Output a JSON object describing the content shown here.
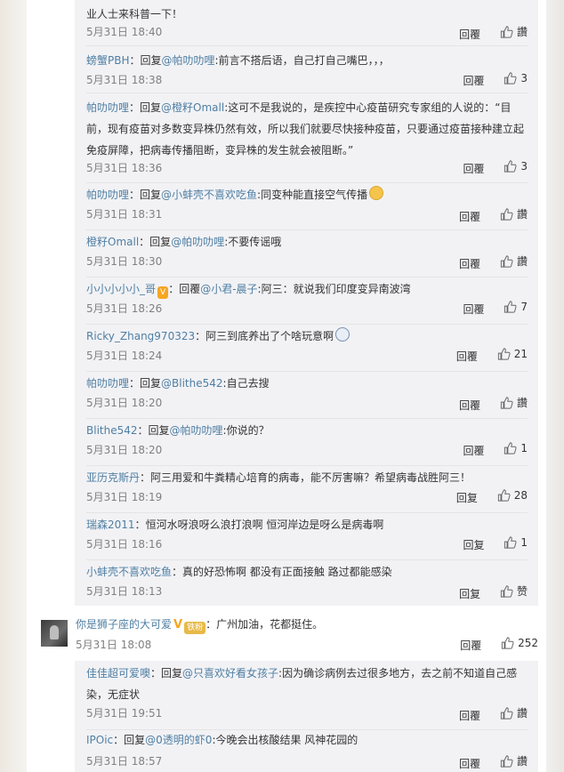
{
  "labels": {
    "reply": "回覆",
    "reply_alt": "回复",
    "like": "讚",
    "like_alt": "赞"
  },
  "replies_group1": [
    {
      "name": "",
      "text": "业人士来科普一下！",
      "time": "5月31日 18:40",
      "likes": "讚"
    },
    {
      "name": "螃蟹PBH",
      "prefix": "：回复",
      "mention": "@帕叻叻哩",
      "text": ":前言不搭后语，自己打自己嘴巴，，，",
      "time": "5月31日 18:38",
      "likes": "3"
    },
    {
      "name": "帕叻叻哩",
      "prefix": "：回复",
      "mention": "@橙籽Omall",
      "text": ":这可不是我说的，是疾控中心疫苗研究专家组的人说的：“目前，现有疫苗对多数变异株仍然有效，所以我们就要尽快接种疫苗，只要通过疫苗接种建立起免疫屏障，把病毒传播阻断，变异株的发生就会被阻断。”",
      "time": "5月31日 18:36",
      "likes": "3"
    },
    {
      "name": "帕叻叻哩",
      "prefix": "：回复",
      "mention": "@小蚌壳不喜欢吃鱼",
      "text": ":同变种能直接空气传播",
      "time": "5月31日 18:31",
      "likes": "讚"
    },
    {
      "name": "橙籽Omall",
      "prefix": "：回复",
      "mention": "@帕叻叻哩",
      "text": ":不要传谣哦",
      "time": "5月31日 18:30",
      "likes": "讚"
    },
    {
      "name": "小小小小小_哥",
      "badge": "V",
      "prefix": "：回覆",
      "mention": "@小君-晨子",
      "text": ":阿三：就说我们印度变异南波湾",
      "time": "5月31日 18:26",
      "likes": "7"
    },
    {
      "name": "Ricky_Zhang970323",
      "prefix": "：",
      "mention": "",
      "text": "阿三到底养出了个啥玩意啊",
      "time": "5月31日 18:24",
      "likes": "21"
    },
    {
      "name": "帕叻叻哩",
      "prefix": "：回复",
      "mention": "@Blithe542",
      "text": ":自己去搜",
      "time": "5月31日 18:20",
      "likes": "讚"
    },
    {
      "name": "Blithe542",
      "prefix": "：回复",
      "mention": "@帕叻叻哩",
      "text": ":你说的？",
      "time": "5月31日 18:20",
      "likes": "1"
    },
    {
      "name": "亚历克斯丹",
      "prefix": "：",
      "mention": "",
      "text": "阿三用爱和牛粪精心培育的病毒，能不厉害嘛？希望病毒战胜阿三！",
      "time": "5月31日 18:19",
      "likes": "28"
    },
    {
      "name": "瑞森2011",
      "prefix": "：",
      "mention": "",
      "text": "恒河水呀浪呀么浪打浪啊 恒河岸边是呀么是病毒啊",
      "time": "5月31日 18:16",
      "likes": "1"
    },
    {
      "name": "小蚌壳不喜欢吃鱼",
      "prefix": "：",
      "mention": "",
      "text": "真的好恐怖啊 都没有正面接触 路过都能感染",
      "time": "5月31日 18:13",
      "likes": "赞"
    }
  ],
  "main_comment": {
    "name": "你是狮子座的大可爱",
    "badge_text": "铁粉",
    "text": "：广州加油，花都挺住。",
    "time": "5月31日 18:08",
    "likes": "252"
  },
  "replies_group2": [
    {
      "name": "佳佳超可爱噢",
      "prefix": "：回复",
      "mention": "@只喜欢好看女孩子",
      "text": ":因为确诊病例去过很多地方，去之前不知道自己感染，无症状",
      "time": "5月31日 19:51",
      "likes": "讚"
    },
    {
      "name": "IPOic",
      "prefix": "：回复",
      "mention": "@0透明的虾0",
      "text": ":今晚会出核酸结果 风神花园的",
      "time": "5月31日 18:57",
      "likes": "讚"
    }
  ],
  "colors": {
    "link": "#4f7fa3",
    "thread_bg": "#f2f2f5",
    "meta": "#808080"
  }
}
